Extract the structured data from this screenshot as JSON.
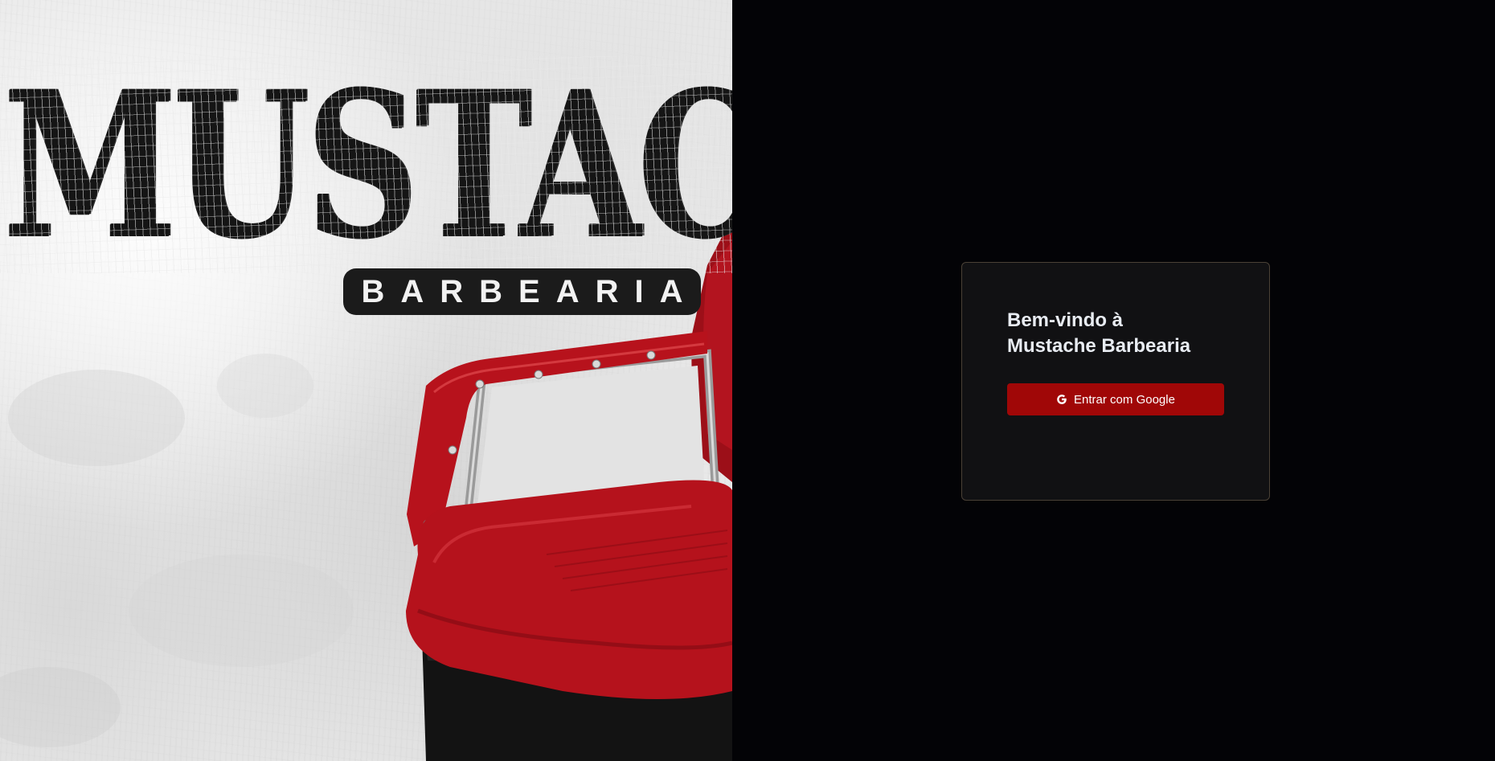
{
  "hero": {
    "logo_word": "MUSTACHE",
    "logo_sub": "BARBEARIA",
    "chair_color": "#b0111b"
  },
  "card": {
    "title_line1": "Bem-vindo à",
    "title_line2": "Mustache Barbearia",
    "google_button_label": "Entrar com Google",
    "google_icon": "google-g-icon"
  },
  "colors": {
    "page_background": "#030306",
    "card_background": "#111113",
    "card_border": "#4a4136",
    "button_background": "#a00707",
    "title_text": "#e8ecf2"
  }
}
